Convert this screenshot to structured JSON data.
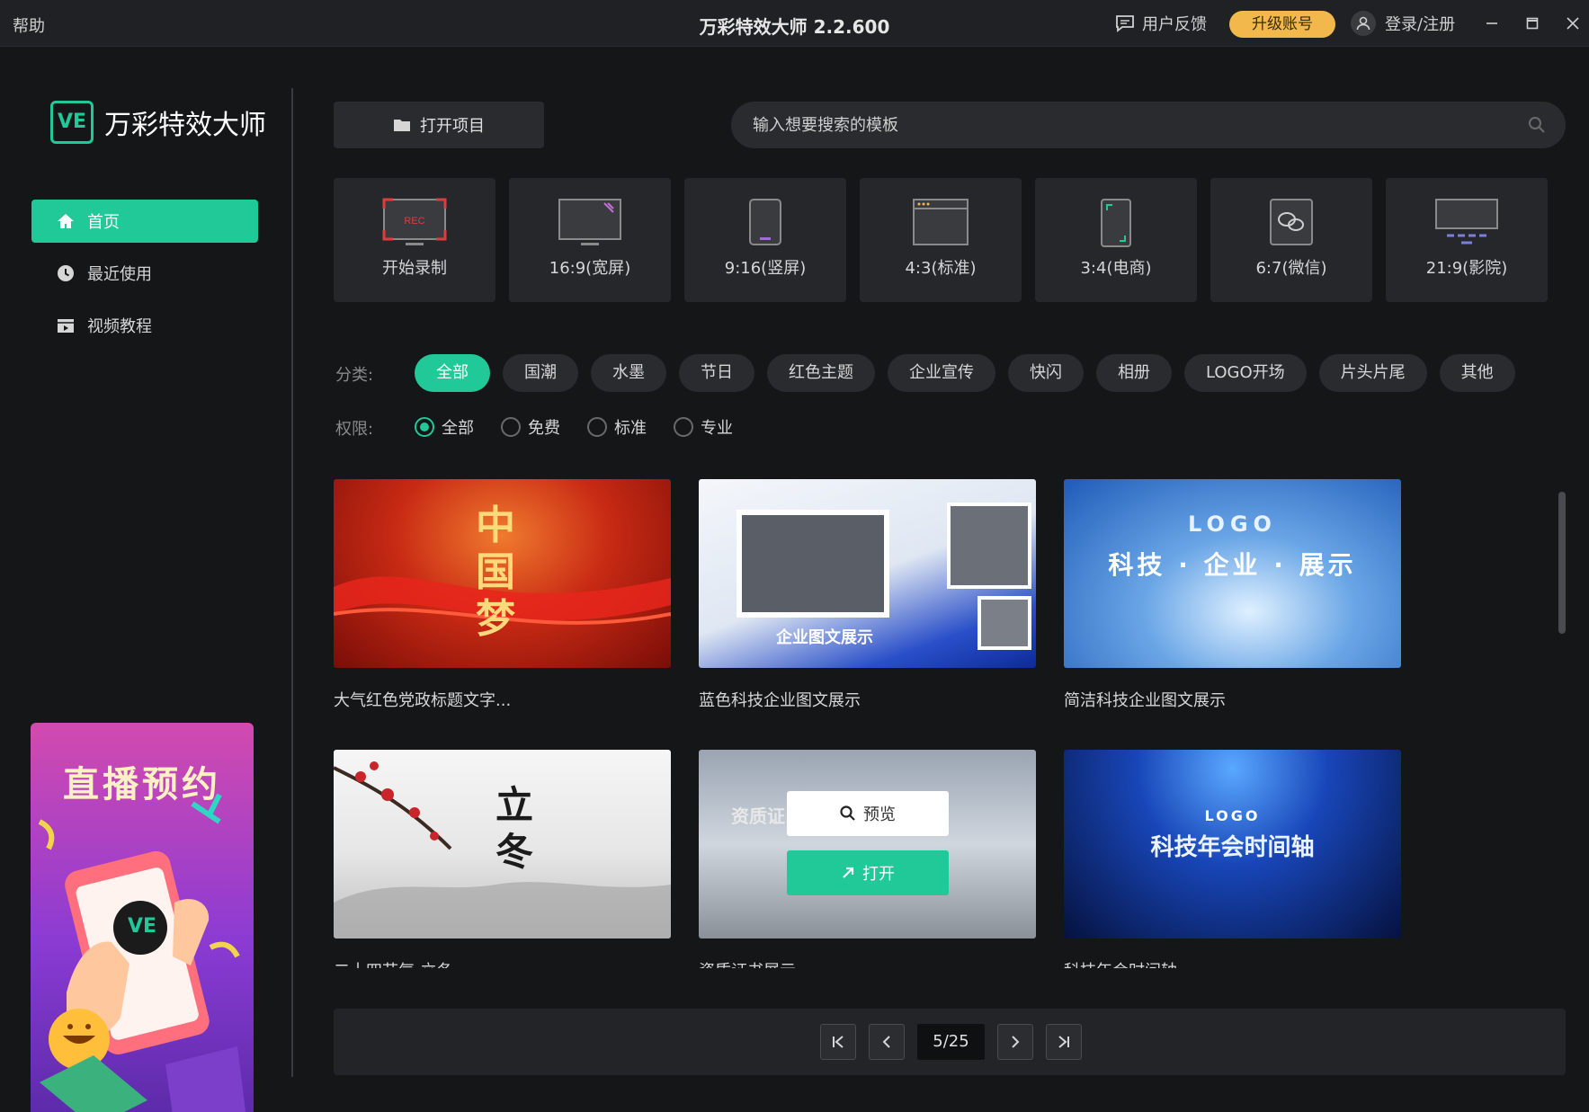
{
  "titlebar": {
    "help": "帮助",
    "title": "万彩特效大师 2.2.600",
    "feedback": "用户反馈",
    "upgrade": "升级账号",
    "login": "登录/注册"
  },
  "sidebar": {
    "logo_badge": "VE",
    "logo_text": "万彩特效大师",
    "items": [
      {
        "label": "首页",
        "icon": "home-icon",
        "active": true
      },
      {
        "label": "最近使用",
        "icon": "clock-icon",
        "active": false
      },
      {
        "label": "视频教程",
        "icon": "video-icon",
        "active": false
      }
    ],
    "promo": {
      "title": "直播预约",
      "badge": "VE"
    }
  },
  "toolbar": {
    "open_project": "打开项目",
    "search_placeholder": "输入想要搜索的模板"
  },
  "ratios": [
    {
      "label": "开始录制",
      "icon": "record-icon",
      "badge": "REC"
    },
    {
      "label": "16:9(宽屏)",
      "icon": "widescreen-icon"
    },
    {
      "label": "9:16(竖屏)",
      "icon": "portrait-icon"
    },
    {
      "label": "4:3(标准)",
      "icon": "standard-icon"
    },
    {
      "label": "3:4(电商)",
      "icon": "ecommerce-icon"
    },
    {
      "label": "6:7(微信)",
      "icon": "wechat-icon"
    },
    {
      "label": "21:9(影院)",
      "icon": "cinema-icon"
    }
  ],
  "filters": {
    "category_label": "分类:",
    "categories": [
      "全部",
      "国潮",
      "水墨",
      "节日",
      "红色主题",
      "企业宣传",
      "快闪",
      "相册",
      "LOGO开场",
      "片头片尾",
      "其他"
    ],
    "active_category": "全部",
    "permission_label": "权限:",
    "permissions": [
      "全部",
      "免费",
      "标准",
      "专业"
    ],
    "active_permission": "全部"
  },
  "templates": [
    {
      "title": "大气红色党政标题文字...",
      "thumb_text": "中国梦"
    },
    {
      "title": "蓝色科技企业图文展示",
      "thumb_text": "企业图文展示"
    },
    {
      "title": "简洁科技企业图文展示",
      "thumb_text": "科技 · 企业 · 展示",
      "thumb_sub": "LOGO"
    },
    {
      "title": "二十四节气-立冬",
      "thumb_text": "立冬"
    },
    {
      "title": "资质证书展示",
      "thumb_text": "资质证"
    },
    {
      "title": "科技年会时间轴",
      "thumb_text": "科技年会时间轴",
      "thumb_sub": "LOGO"
    }
  ],
  "hover": {
    "preview": "预览",
    "open": "打开"
  },
  "pagination": {
    "current": "5/25"
  },
  "colors": {
    "accent": "#20c997",
    "upgrade": "#f2b84b",
    "bg": "#151618",
    "panel": "#26272b"
  }
}
